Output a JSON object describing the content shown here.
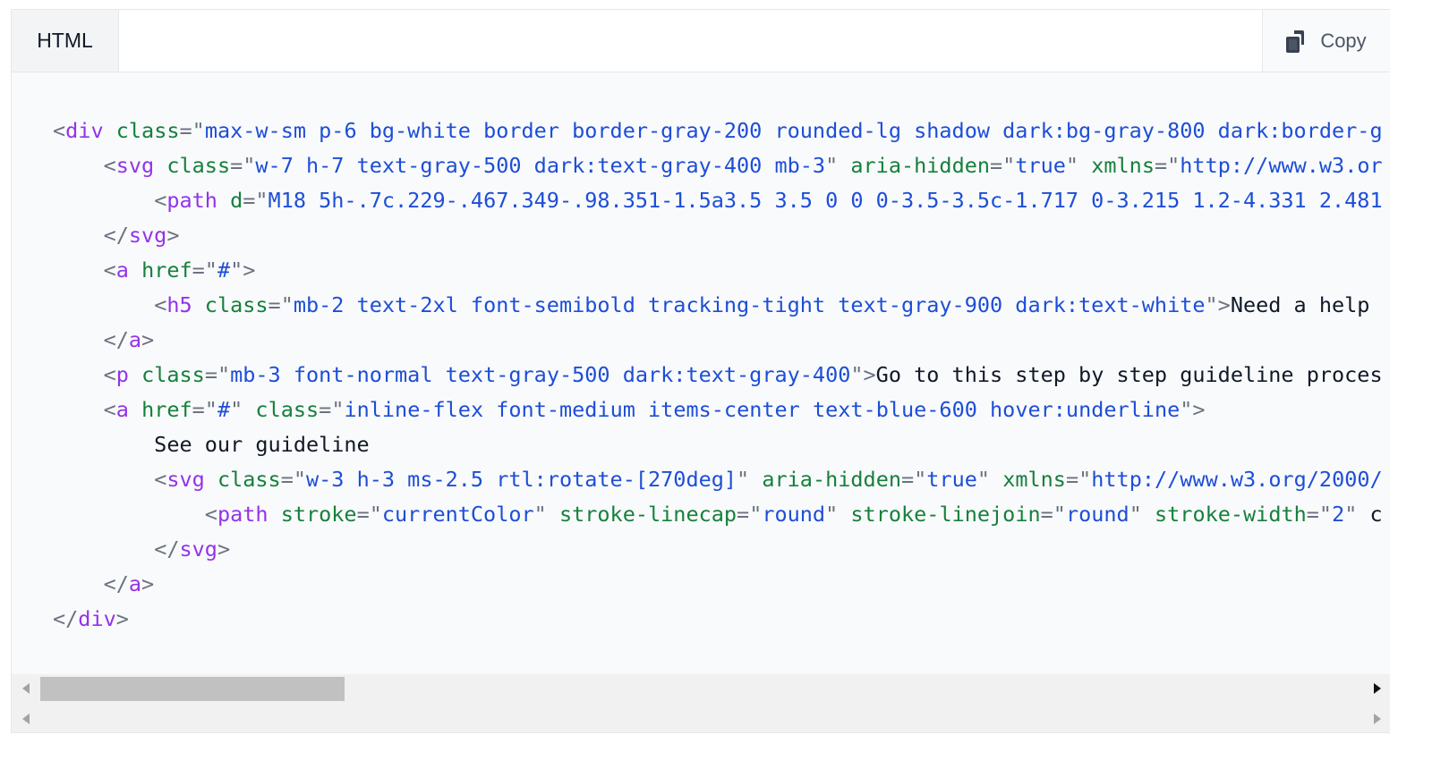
{
  "tab": {
    "label": "HTML"
  },
  "toolbar": {
    "copy_label": "Copy"
  },
  "icons": {
    "copy": "clipboard-copy-icon",
    "scroll_left": "arrow-left-icon",
    "scroll_right": "arrow-right-icon"
  },
  "code_lines": [
    [
      [
        "p",
        "<"
      ],
      [
        "t",
        "div"
      ],
      [
        "x",
        " "
      ],
      [
        "a",
        "class"
      ],
      [
        "p",
        "=\""
      ],
      [
        "v",
        "max-w-sm p-6 bg-white border border-gray-200 rounded-lg shadow dark:bg-gray-800 dark:border-g"
      ]
    ],
    [
      [
        "x",
        "    "
      ],
      [
        "p",
        "<"
      ],
      [
        "t",
        "svg"
      ],
      [
        "x",
        " "
      ],
      [
        "a",
        "class"
      ],
      [
        "p",
        "=\""
      ],
      [
        "v",
        "w-7 h-7 text-gray-500 dark:text-gray-400 mb-3"
      ],
      [
        "p",
        "\""
      ],
      [
        "x",
        " "
      ],
      [
        "a",
        "aria-hidden"
      ],
      [
        "p",
        "=\""
      ],
      [
        "v",
        "true"
      ],
      [
        "p",
        "\""
      ],
      [
        "x",
        " "
      ],
      [
        "a",
        "xmlns"
      ],
      [
        "p",
        "=\""
      ],
      [
        "v",
        "http://www.w3.or"
      ]
    ],
    [
      [
        "x",
        "        "
      ],
      [
        "p",
        "<"
      ],
      [
        "t",
        "path"
      ],
      [
        "x",
        " "
      ],
      [
        "a",
        "d"
      ],
      [
        "p",
        "=\""
      ],
      [
        "v",
        "M18 5h-.7c.229-.467.349-.98.351-1.5a3.5 3.5 0 0 0-3.5-3.5c-1.717 0-3.215 1.2-4.331 2.481"
      ]
    ],
    [
      [
        "x",
        "    "
      ],
      [
        "p",
        "</"
      ],
      [
        "t",
        "svg"
      ],
      [
        "p",
        ">"
      ]
    ],
    [
      [
        "x",
        "    "
      ],
      [
        "p",
        "<"
      ],
      [
        "t",
        "a"
      ],
      [
        "x",
        " "
      ],
      [
        "a",
        "href"
      ],
      [
        "p",
        "=\""
      ],
      [
        "v",
        "#"
      ],
      [
        "p",
        "\">"
      ]
    ],
    [
      [
        "x",
        "        "
      ],
      [
        "p",
        "<"
      ],
      [
        "t",
        "h5"
      ],
      [
        "x",
        " "
      ],
      [
        "a",
        "class"
      ],
      [
        "p",
        "=\""
      ],
      [
        "v",
        "mb-2 text-2xl font-semibold tracking-tight text-gray-900 dark:text-white"
      ],
      [
        "p",
        "\">"
      ],
      [
        "x",
        "Need a help"
      ]
    ],
    [
      [
        "x",
        "    "
      ],
      [
        "p",
        "</"
      ],
      [
        "t",
        "a"
      ],
      [
        "p",
        ">"
      ]
    ],
    [
      [
        "x",
        "    "
      ],
      [
        "p",
        "<"
      ],
      [
        "t",
        "p"
      ],
      [
        "x",
        " "
      ],
      [
        "a",
        "class"
      ],
      [
        "p",
        "=\""
      ],
      [
        "v",
        "mb-3 font-normal text-gray-500 dark:text-gray-400"
      ],
      [
        "p",
        "\">"
      ],
      [
        "x",
        "Go to this step by step guideline proces"
      ]
    ],
    [
      [
        "x",
        "    "
      ],
      [
        "p",
        "<"
      ],
      [
        "t",
        "a"
      ],
      [
        "x",
        " "
      ],
      [
        "a",
        "href"
      ],
      [
        "p",
        "=\""
      ],
      [
        "v",
        "#"
      ],
      [
        "p",
        "\""
      ],
      [
        "x",
        " "
      ],
      [
        "a",
        "class"
      ],
      [
        "p",
        "=\""
      ],
      [
        "v",
        "inline-flex font-medium items-center text-blue-600 hover:underline"
      ],
      [
        "p",
        "\">"
      ]
    ],
    [
      [
        "x",
        "        See our guideline"
      ]
    ],
    [
      [
        "x",
        "        "
      ],
      [
        "p",
        "<"
      ],
      [
        "t",
        "svg"
      ],
      [
        "x",
        " "
      ],
      [
        "a",
        "class"
      ],
      [
        "p",
        "=\""
      ],
      [
        "v",
        "w-3 h-3 ms-2.5 rtl:rotate-[270deg]"
      ],
      [
        "p",
        "\""
      ],
      [
        "x",
        " "
      ],
      [
        "a",
        "aria-hidden"
      ],
      [
        "p",
        "=\""
      ],
      [
        "v",
        "true"
      ],
      [
        "p",
        "\""
      ],
      [
        "x",
        " "
      ],
      [
        "a",
        "xmlns"
      ],
      [
        "p",
        "=\""
      ],
      [
        "v",
        "http://www.w3.org/2000/"
      ]
    ],
    [
      [
        "x",
        "            "
      ],
      [
        "p",
        "<"
      ],
      [
        "t",
        "path"
      ],
      [
        "x",
        " "
      ],
      [
        "a",
        "stroke"
      ],
      [
        "p",
        "=\""
      ],
      [
        "v",
        "currentColor"
      ],
      [
        "p",
        "\""
      ],
      [
        "x",
        " "
      ],
      [
        "a",
        "stroke-linecap"
      ],
      [
        "p",
        "=\""
      ],
      [
        "v",
        "round"
      ],
      [
        "p",
        "\""
      ],
      [
        "x",
        " "
      ],
      [
        "a",
        "stroke-linejoin"
      ],
      [
        "p",
        "=\""
      ],
      [
        "v",
        "round"
      ],
      [
        "p",
        "\""
      ],
      [
        "x",
        " "
      ],
      [
        "a",
        "stroke-width"
      ],
      [
        "p",
        "=\""
      ],
      [
        "v",
        "2"
      ],
      [
        "p",
        "\""
      ],
      [
        "x",
        " c"
      ]
    ],
    [
      [
        "x",
        "        "
      ],
      [
        "p",
        "</"
      ],
      [
        "t",
        "svg"
      ],
      [
        "p",
        ">"
      ]
    ],
    [
      [
        "x",
        "    "
      ],
      [
        "p",
        "</"
      ],
      [
        "t",
        "a"
      ],
      [
        "p",
        ">"
      ]
    ],
    [
      [
        "p",
        "</"
      ],
      [
        "t",
        "div"
      ],
      [
        "p",
        ">"
      ]
    ]
  ]
}
